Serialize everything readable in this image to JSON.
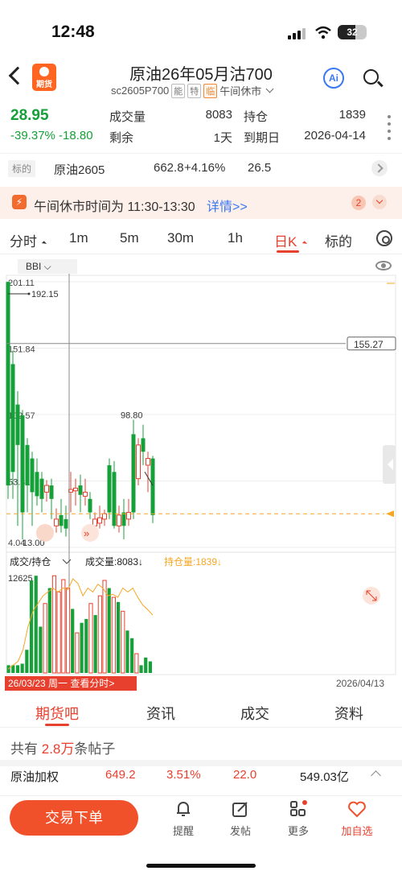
{
  "status": {
    "time": "12:48",
    "battery": "32"
  },
  "header": {
    "logo_text": "期货",
    "title": "原油26年05月沽700",
    "code": "sc2605P700",
    "tag1": "能",
    "tag2": "特",
    "tag3": "临",
    "session": "午间休市",
    "ai": "Ai"
  },
  "quote": {
    "price": "28.95",
    "change_pct": "-39.37%",
    "change": "-18.80",
    "vol_label": "成交量",
    "vol": "8083",
    "oi_label": "持仓",
    "oi": "1839",
    "remain_label": "剩余",
    "remain": "1天",
    "expiry_label": "到期日",
    "expiry": "2026-04-14"
  },
  "underlying": {
    "tag": "标的",
    "name": "原油2605",
    "price": "662.8",
    "pct": "+4.16%",
    "change": "26.5"
  },
  "banner": {
    "text": "午间休市时间为 11:30-13:30",
    "link": "详情>>",
    "count": "2"
  },
  "tabs": [
    "分时",
    "1m",
    "5m",
    "30m",
    "1h",
    "日K",
    "标的"
  ],
  "indicator": "BBI",
  "chart_data": {
    "type": "candlestick",
    "y_labels": [
      "201.11",
      "151.84",
      "102.57",
      "53.31",
      "4.04"
    ],
    "max_label": "192.15",
    "high_label": "98.80",
    "low_label": "13.00",
    "crosshair_label": "155.27",
    "vol_title": "成交/持仓",
    "vol_text": "成交量:8083↓",
    "oi_text": "持仓量:1839↓",
    "vol_max": "12625",
    "date_left": "26/03/23 周一 查看分时>",
    "date_right": "2026/04/13",
    "candles": [
      {
        "o": 50,
        "c": 201,
        "h": 201,
        "l": 40,
        "dir": "down"
      },
      {
        "o": 140,
        "c": 60,
        "h": 150,
        "l": 40,
        "dir": "down"
      },
      {
        "o": 110,
        "c": 80,
        "h": 120,
        "l": 20,
        "dir": "down"
      },
      {
        "o": 102,
        "c": 30,
        "h": 106,
        "l": 10,
        "dir": "down"
      },
      {
        "o": 80,
        "c": 50,
        "h": 85,
        "l": 30,
        "dir": "down"
      },
      {
        "o": 70,
        "c": 45,
        "h": 75,
        "l": 20,
        "dir": "down"
      },
      {
        "o": 60,
        "c": 42,
        "h": 70,
        "l": 35,
        "dir": "down"
      },
      {
        "o": 55,
        "c": 40,
        "h": 60,
        "l": 30,
        "dir": "down"
      },
      {
        "o": 45,
        "c": 50,
        "h": 54,
        "l": 38,
        "dir": "up"
      },
      {
        "o": 50,
        "c": 40,
        "h": 55,
        "l": 25,
        "dir": "down"
      },
      {
        "o": 20,
        "c": 25,
        "h": 33,
        "l": 15,
        "dir": "up"
      },
      {
        "o": 28,
        "c": 20,
        "h": 40,
        "l": 15,
        "dir": "down"
      },
      {
        "o": 25,
        "c": 18,
        "h": 35,
        "l": 12,
        "dir": "down"
      },
      {
        "o": 45,
        "c": 47,
        "h": 60,
        "l": 30,
        "dir": "up"
      },
      {
        "o": 46,
        "c": 48,
        "h": 55,
        "l": 35,
        "dir": "up"
      },
      {
        "o": 50,
        "c": 43,
        "h": 58,
        "l": 30,
        "dir": "down"
      },
      {
        "o": 42,
        "c": 45,
        "h": 55,
        "l": 35,
        "dir": "up"
      },
      {
        "o": 40,
        "c": 30,
        "h": 45,
        "l": 25,
        "dir": "down"
      },
      {
        "o": 20,
        "c": 25,
        "h": 30,
        "l": 15,
        "dir": "up"
      },
      {
        "o": 22,
        "c": 26,
        "h": 35,
        "l": 18,
        "dir": "up"
      },
      {
        "o": 25,
        "c": 29,
        "h": 32,
        "l": 20,
        "dir": "up"
      },
      {
        "o": 65,
        "c": 30,
        "h": 70,
        "l": 25,
        "dir": "down"
      },
      {
        "o": 60,
        "c": 20,
        "h": 68,
        "l": 18,
        "dir": "down"
      },
      {
        "o": 20,
        "c": 28,
        "h": 35,
        "l": 15,
        "dir": "up"
      },
      {
        "o": 30,
        "c": 20,
        "h": 40,
        "l": 10,
        "dir": "down"
      },
      {
        "o": 25,
        "c": 30,
        "h": 40,
        "l": 20,
        "dir": "up"
      },
      {
        "o": 88,
        "c": 30,
        "h": 98.8,
        "l": 25,
        "dir": "down"
      },
      {
        "o": 55,
        "c": 80,
        "h": 85,
        "l": 50,
        "dir": "up"
      },
      {
        "o": 75,
        "c": 85,
        "h": 95,
        "l": 65,
        "dir": "down"
      },
      {
        "o": 65,
        "c": 70,
        "h": 75,
        "l": 45,
        "dir": "up"
      },
      {
        "o": 70,
        "c": 28,
        "h": 72,
        "l": 22,
        "dir": "down"
      }
    ],
    "volumes": [
      1,
      1,
      1,
      1.2,
      3,
      12,
      12.6,
      6,
      9,
      11,
      12.6,
      10.5,
      12.1,
      11,
      8.3,
      5.2,
      6.5,
      7,
      9,
      7.5,
      10,
      12,
      11,
      9.8,
      9.2,
      8,
      5.5,
      4.5,
      2.5,
      1,
      2,
      1.5
    ],
    "vol_dir": [
      "down",
      "down",
      "down",
      "down",
      "down",
      "down",
      "down",
      "down",
      "up",
      "down",
      "up",
      "up",
      "up",
      "up",
      "down",
      "up",
      "down",
      "down",
      "up",
      "down",
      "up",
      "up",
      "down",
      "up",
      "down",
      "up",
      "down",
      "down",
      "up",
      "down",
      "down",
      "down"
    ]
  },
  "subtabs": [
    "期货吧",
    "资讯",
    "成交",
    "资料"
  ],
  "posts": {
    "prefix": "共有",
    "num": "2.8万",
    "suffix": "条帖子"
  },
  "index": {
    "name": "原油加权",
    "price": "649.2",
    "pct": "3.51%",
    "change": "22.0",
    "amount": "549.03亿"
  },
  "bottom": {
    "trade": "交易下单",
    "remind": "提醒",
    "post": "发帖",
    "more": "更多",
    "fav": "加自选"
  }
}
